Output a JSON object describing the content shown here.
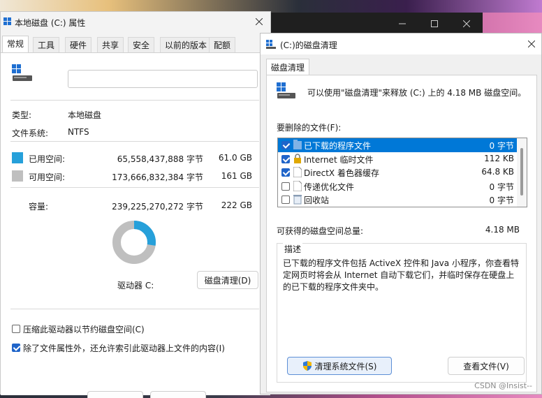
{
  "properties_window": {
    "title": "本地磁盘 (C:) 属性",
    "tabs": [
      "常规",
      "工具",
      "硬件",
      "共享",
      "安全",
      "以前的版本",
      "配额"
    ],
    "active_tab": "常规",
    "name_field_value": "",
    "type_label": "类型:",
    "type_value": "本地磁盘",
    "fs_label": "文件系统:",
    "fs_value": "NTFS",
    "used": {
      "label": "已用空间:",
      "bytes": "65,558,437,888 字节",
      "size": "61.0 GB",
      "color": "#26a0da"
    },
    "free": {
      "label": "可用空间:",
      "bytes": "173,666,832,384 字节",
      "size": "161 GB",
      "color": "#bfbfbf"
    },
    "capacity": {
      "label": "容量:",
      "bytes": "239,225,270,272 字节",
      "size": "222 GB"
    },
    "used_fraction": 0.275,
    "drive_label": "驱动器 C:",
    "cleanup_button": "磁盘清理(D)",
    "compress_label": "压缩此驱动器以节约磁盘空间(C)",
    "compress_checked": false,
    "index_label": "除了文件属性外，还允许索引此驱动器上文件的内容(I)",
    "index_checked": true
  },
  "cleanup_window": {
    "title": "(C:)的磁盘清理",
    "tab": "磁盘清理",
    "intro": "可以使用\"磁盘清理\"来释放  (C:) 上的 4.18 MB 磁盘空间。",
    "files_label": "要删除的文件(F):",
    "files": [
      {
        "name": "已下载的程序文件",
        "size": "0 字节",
        "checked": true,
        "selected": true,
        "icon": "folder-icon"
      },
      {
        "name": "Internet 临时文件",
        "size": "112 KB",
        "checked": true,
        "selected": false,
        "icon": "lock-icon"
      },
      {
        "name": "DirectX 着色器缓存",
        "size": "64.8 KB",
        "checked": true,
        "selected": false,
        "icon": "file-icon"
      },
      {
        "name": "传递优化文件",
        "size": "0 字节",
        "checked": false,
        "selected": false,
        "icon": "file-icon"
      },
      {
        "name": "回收站",
        "size": "0 字节",
        "checked": false,
        "selected": false,
        "icon": "recycle-bin-icon"
      }
    ],
    "total_label": "可获得的磁盘空间总量:",
    "total_value": "4.18 MB",
    "desc_title": "描述",
    "desc_text": "已下载的程序文件包括 ActiveX 控件和 Java 小程序，你查看特定网页时将会从 Internet 自动下载它们，并临时保存在硬盘上的已下载的程序文件夹中。",
    "cleanup_system_button": "清理系统文件(S)",
    "view_files_button": "查看文件(V)"
  },
  "watermark": "CSDN @Insist--"
}
